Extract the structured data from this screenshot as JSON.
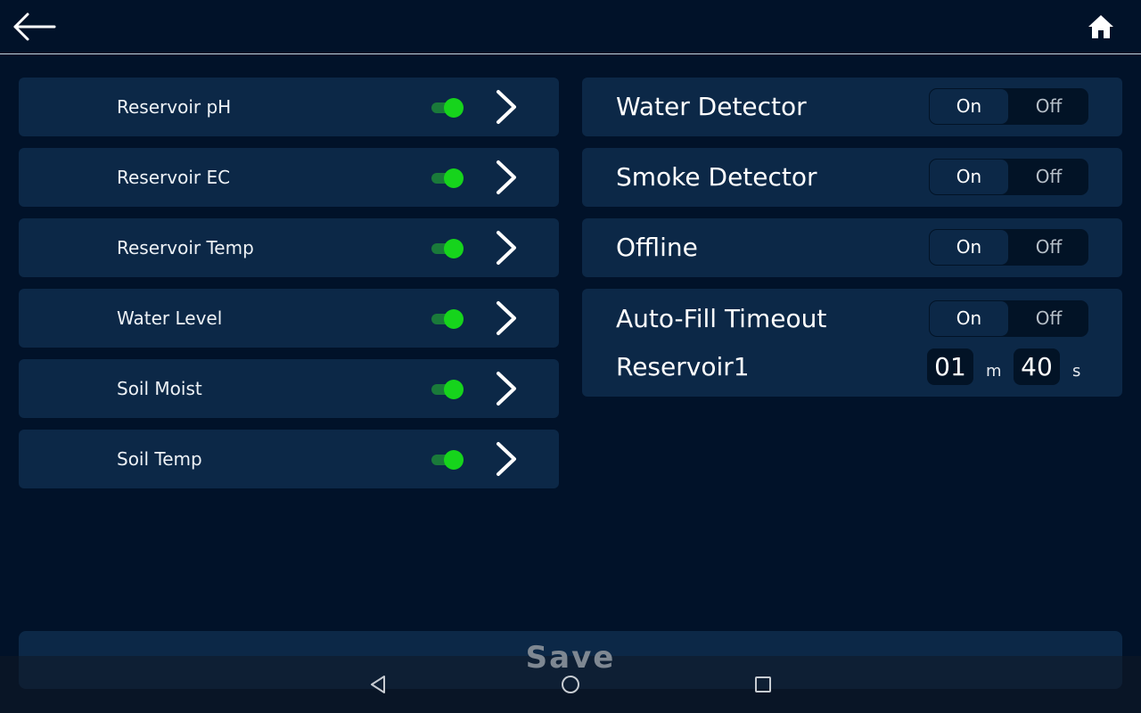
{
  "header": {
    "back_icon": "arrow-left-icon",
    "home_icon": "home-icon"
  },
  "sensors": [
    {
      "label": "Reservoir pH",
      "enabled": true
    },
    {
      "label": "Reservoir EC",
      "enabled": true
    },
    {
      "label": "Reservoir Temp",
      "enabled": true
    },
    {
      "label": "Water Level",
      "enabled": true
    },
    {
      "label": "Soil Moist",
      "enabled": true
    },
    {
      "label": "Soil Temp",
      "enabled": true
    }
  ],
  "detectors": [
    {
      "label": "Water Detector",
      "on_label": "On",
      "off_label": "Off",
      "selected": "On"
    },
    {
      "label": "Smoke Detector",
      "on_label": "On",
      "off_label": "Off",
      "selected": "On"
    },
    {
      "label": "Offline",
      "on_label": "On",
      "off_label": "Off",
      "selected": "On"
    }
  ],
  "auto_fill": {
    "title": "Auto-Fill Timeout",
    "on_label": "On",
    "off_label": "Off",
    "selected": "On",
    "reservoir_label": "Reservoir1",
    "minutes": "01",
    "minutes_unit": "m",
    "seconds": "40",
    "seconds_unit": "s"
  },
  "footer": {
    "save_label": "Save"
  },
  "colors": {
    "background": "#011229",
    "card": "#0c2847",
    "toggle_on": "#16d41c",
    "toggle_track": "#1a7a3a"
  }
}
